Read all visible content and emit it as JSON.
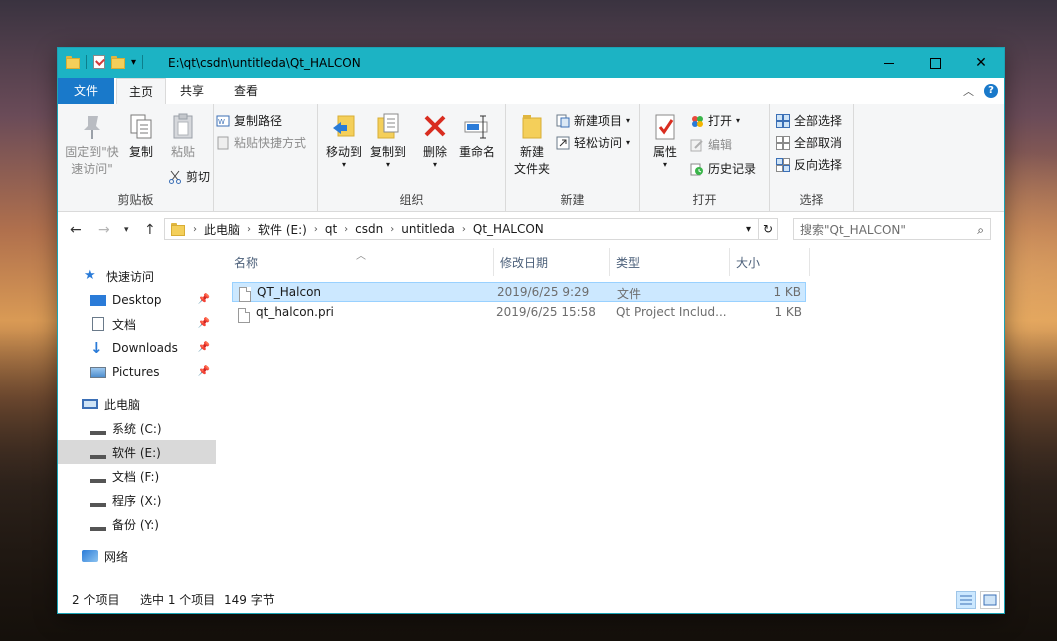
{
  "titlebar": {
    "path": "E:\\qt\\csdn\\untitleda\\Qt_HALCON"
  },
  "ribbon_tabs": {
    "file": "文件",
    "home": "主页",
    "share": "共享",
    "view": "查看"
  },
  "clipboard": {
    "pin": "固定到\"快\n速访问\"",
    "copy": "复制",
    "paste": "粘贴",
    "copy_path": "复制路径",
    "paste_shortcut": "粘贴快捷方式",
    "cut": "剪切",
    "group": "剪贴板"
  },
  "organize": {
    "move_to": "移动到",
    "copy_to": "复制到",
    "delete": "删除",
    "rename": "重命名",
    "group": "组织"
  },
  "new_group": {
    "new_folder": "新建\n文件夹",
    "new_item": "新建项目",
    "easy_access": "轻松访问",
    "group": "新建"
  },
  "open_group": {
    "properties": "属性",
    "open": "打开",
    "edit": "编辑",
    "history": "历史记录",
    "group": "打开"
  },
  "select_group": {
    "select_all": "全部选择",
    "select_none": "全部取消",
    "invert": "反向选择",
    "group": "选择"
  },
  "breadcrumb": [
    "此电脑",
    "软件 (E:)",
    "qt",
    "csdn",
    "untitleda",
    "Qt_HALCON"
  ],
  "search": {
    "placeholder": "搜索\"Qt_HALCON\""
  },
  "nav": {
    "quick_access": "快速访问",
    "desktop": "Desktop",
    "documents": "文档",
    "downloads": "Downloads",
    "pictures": "Pictures",
    "this_pc": "此电脑",
    "drive_c": "系统 (C:)",
    "drive_e": "软件 (E:)",
    "drive_f": "文档 (F:)",
    "drive_x": "程序 (X:)",
    "drive_y": "备份 (Y:)",
    "network": "网络"
  },
  "columns": {
    "name": "名称",
    "modified": "修改日期",
    "type": "类型",
    "size": "大小"
  },
  "files": [
    {
      "name": "QT_Halcon",
      "modified": "2019/6/25 9:29",
      "type": "文件",
      "size": "1 KB"
    },
    {
      "name": "qt_halcon.pri",
      "modified": "2019/6/25 15:58",
      "type": "Qt Project Includ...",
      "size": "1 KB"
    }
  ],
  "status": {
    "count": "2 个项目",
    "selected": "选中 1 个项目",
    "bytes": "149 字节"
  },
  "colors": {
    "titlebar": "#1cb3c4",
    "file_tab": "#1979ca",
    "selection": "#cce8ff"
  }
}
